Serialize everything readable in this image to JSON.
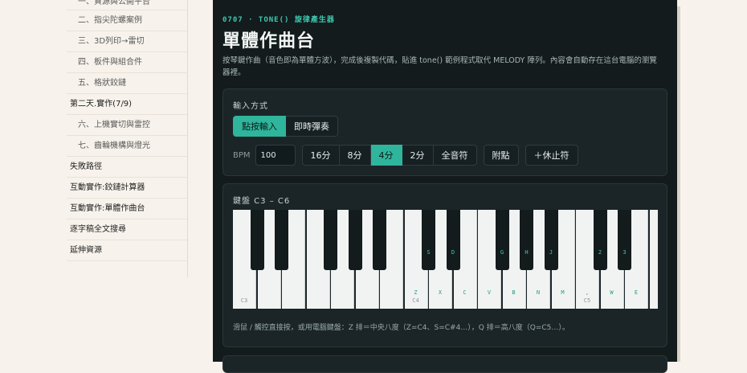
{
  "sidebar": {
    "items": [
      {
        "label": "一、資源與公開平台",
        "level": "sub"
      },
      {
        "label": "二、指尖陀螺案例",
        "level": "sub"
      },
      {
        "label": "三、3D列印→雷切",
        "level": "sub"
      },
      {
        "label": "四、板件與組合件",
        "level": "sub"
      },
      {
        "label": "五、格狀鉸鏈",
        "level": "sub"
      },
      {
        "label": "第二天.實作(7/9)",
        "level": "top"
      },
      {
        "label": "六、上機實切與雷控",
        "level": "sub"
      },
      {
        "label": "七、齒輪機構與燈光",
        "level": "sub"
      },
      {
        "label": "失敗路徑",
        "level": "top"
      },
      {
        "label": "互動實作:鉸鏈計算器",
        "level": "top"
      },
      {
        "label": "互動實作:單體作曲台",
        "level": "top"
      },
      {
        "label": "逐字稿全文搜尋",
        "level": "top"
      },
      {
        "label": "延伸資源",
        "level": "top"
      }
    ]
  },
  "header": {
    "eyebrow": "0707 · TONE() 旋律產生器",
    "title": "單體作曲台",
    "description": "按琴鍵作曲（音色即為單體方波），完成後複製代碼，貼進 tone() 範例程式取代 MELODY 陣列。內容會自動存在這台電腦的瀏覽器裡。"
  },
  "input_card": {
    "label": "輸入方式",
    "modes": [
      "點按輸入",
      "即時彈奏"
    ],
    "active_mode": "點按輸入",
    "bpm_label": "BPM",
    "bpm_value": "100",
    "durations": [
      "16分",
      "8分",
      "4分",
      "2分",
      "全音符"
    ],
    "active_duration": "4分",
    "dotted_label": "附點",
    "rest_label": "＋休止符"
  },
  "keyboard_card": {
    "label": "鍵盤 C3 – C6",
    "white_keys": [
      {
        "note": "C3",
        "key": ""
      },
      {
        "note": "",
        "key": ""
      },
      {
        "note": "",
        "key": ""
      },
      {
        "note": "",
        "key": ""
      },
      {
        "note": "",
        "key": ""
      },
      {
        "note": "",
        "key": ""
      },
      {
        "note": "",
        "key": ""
      },
      {
        "note": "C4",
        "key": "Z"
      },
      {
        "note": "",
        "key": "X"
      },
      {
        "note": "",
        "key": "C"
      },
      {
        "note": "",
        "key": "V"
      },
      {
        "note": "",
        "key": "B"
      },
      {
        "note": "",
        "key": "N"
      },
      {
        "note": "",
        "key": "M"
      },
      {
        "note": "C5",
        "key": ","
      },
      {
        "note": "",
        "key": "W"
      },
      {
        "note": "",
        "key": "E"
      },
      {
        "note": "",
        "key": ""
      }
    ],
    "black_keys": [
      {
        "after_white": 0,
        "key": ""
      },
      {
        "after_white": 1,
        "key": ""
      },
      {
        "after_white": 3,
        "key": ""
      },
      {
        "after_white": 4,
        "key": ""
      },
      {
        "after_white": 5,
        "key": ""
      },
      {
        "after_white": 7,
        "key": "S"
      },
      {
        "after_white": 8,
        "key": "D"
      },
      {
        "after_white": 10,
        "key": "G"
      },
      {
        "after_white": 11,
        "key": "H"
      },
      {
        "after_white": 12,
        "key": "J"
      },
      {
        "after_white": 14,
        "key": "2"
      },
      {
        "after_white": 15,
        "key": "3"
      }
    ],
    "hint": "滑鼠 / 觸控直接按，或用電腦鍵盤：Z 排＝中央八度（Z=C4、S=C#4…），Q 排＝高八度（Q=C5…）。"
  },
  "colors": {
    "accent": "#2fb59b",
    "panel_bg": "#131b1d",
    "page_bg": "#f7f3ec"
  }
}
